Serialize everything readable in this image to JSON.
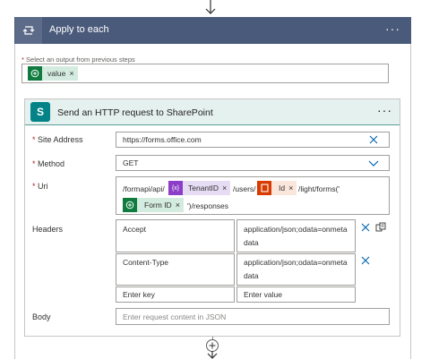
{
  "loop": {
    "title": "Apply to each",
    "more": "···",
    "select_label": "Select an output from previous steps",
    "required_marker": "*",
    "token": {
      "label": "value",
      "remove": "×",
      "color": "#d4ecdf"
    }
  },
  "action": {
    "title": "Send an HTTP request to SharePoint",
    "more": "···",
    "icon_letter": "S",
    "fields": {
      "site_address": {
        "label": "Site Address",
        "value": "https://forms.office.com"
      },
      "method": {
        "label": "Method",
        "value": "GET"
      },
      "uri": {
        "label": "Uri",
        "seg1": "/formapi/api/",
        "token_tenant": "TenantID",
        "seg2": "/users/",
        "token_id": "Id",
        "seg3": "/light/forms('",
        "token_form": "Form ID",
        "seg4": "')/responses",
        "remove": "×"
      },
      "headers": {
        "label": "Headers",
        "rows": [
          {
            "key": "Accept",
            "value_l1": "application/json;odata=onmeta",
            "value_l2": "data"
          },
          {
            "key": "Content-Type",
            "value_l1": "application/json;odata=onmeta",
            "value_l2": "data"
          }
        ],
        "key_placeholder": "Enter key",
        "value_placeholder": "Enter value"
      },
      "body": {
        "label": "Body",
        "placeholder": "Enter request content in JSON"
      }
    }
  },
  "colors": {
    "loop_header": "#4a5a7a",
    "action_header": "#e5f1ef",
    "sharepoint": "#038387",
    "required": "#a4262c"
  }
}
